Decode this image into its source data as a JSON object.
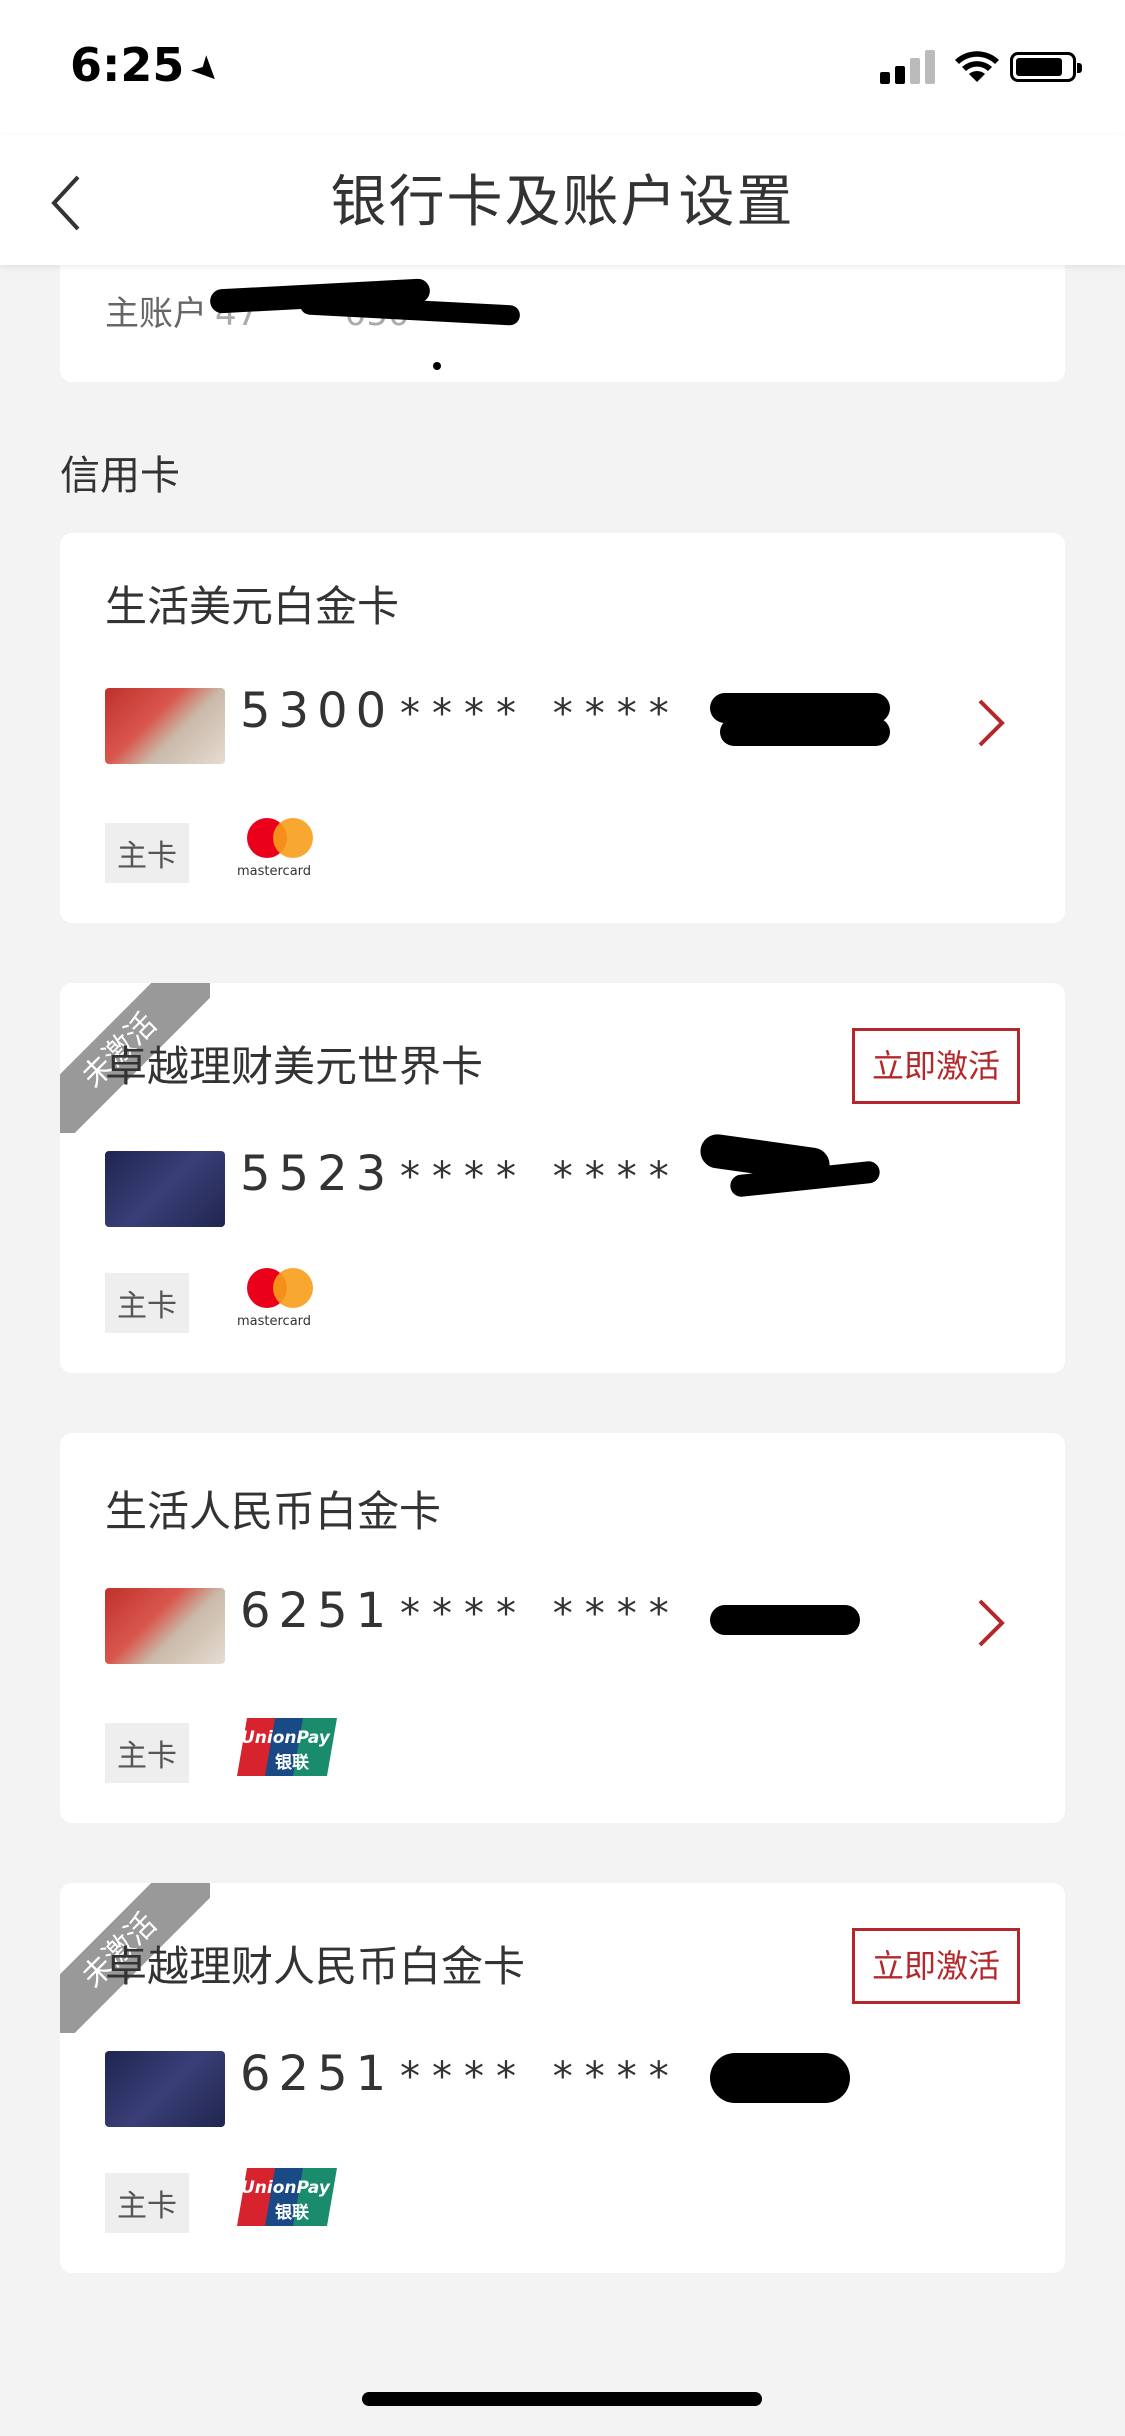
{
  "status": {
    "time": "6:25"
  },
  "nav": {
    "title": "银行卡及账户设置"
  },
  "account": {
    "label": "主账户",
    "number_partial": "47",
    "number_tail": "050"
  },
  "section": {
    "credit_title": "信用卡"
  },
  "cards": [
    {
      "name": "生活美元白金卡",
      "prefix": "5300",
      "masked": "**** ****",
      "tag": "主卡",
      "brand": "mastercard",
      "inactive": false
    },
    {
      "name": "卓越理财美元世界卡",
      "prefix": "5523",
      "masked": "**** ****",
      "tag": "主卡",
      "brand": "mastercard",
      "inactive": true,
      "ribbon": "未激活",
      "activate": "立即激活"
    },
    {
      "name": "生活人民币白金卡",
      "prefix": "6251",
      "masked": "**** ****",
      "tag": "主卡",
      "brand": "unionpay",
      "inactive": false
    },
    {
      "name": "卓越理财人民币白金卡",
      "prefix": "6251",
      "masked": "**** ****",
      "tag": "主卡",
      "brand": "unionpay",
      "inactive": true,
      "ribbon": "未激活",
      "activate": "立即激活"
    }
  ],
  "brands": {
    "mastercard": "mastercard",
    "unionpay_en": "UnionPay",
    "unionpay_cn": "银联"
  },
  "colors": {
    "accent": "#b4272a",
    "ribbon": "#999999",
    "mc_red": "#eb001b",
    "mc_orange": "#f79e1b"
  }
}
